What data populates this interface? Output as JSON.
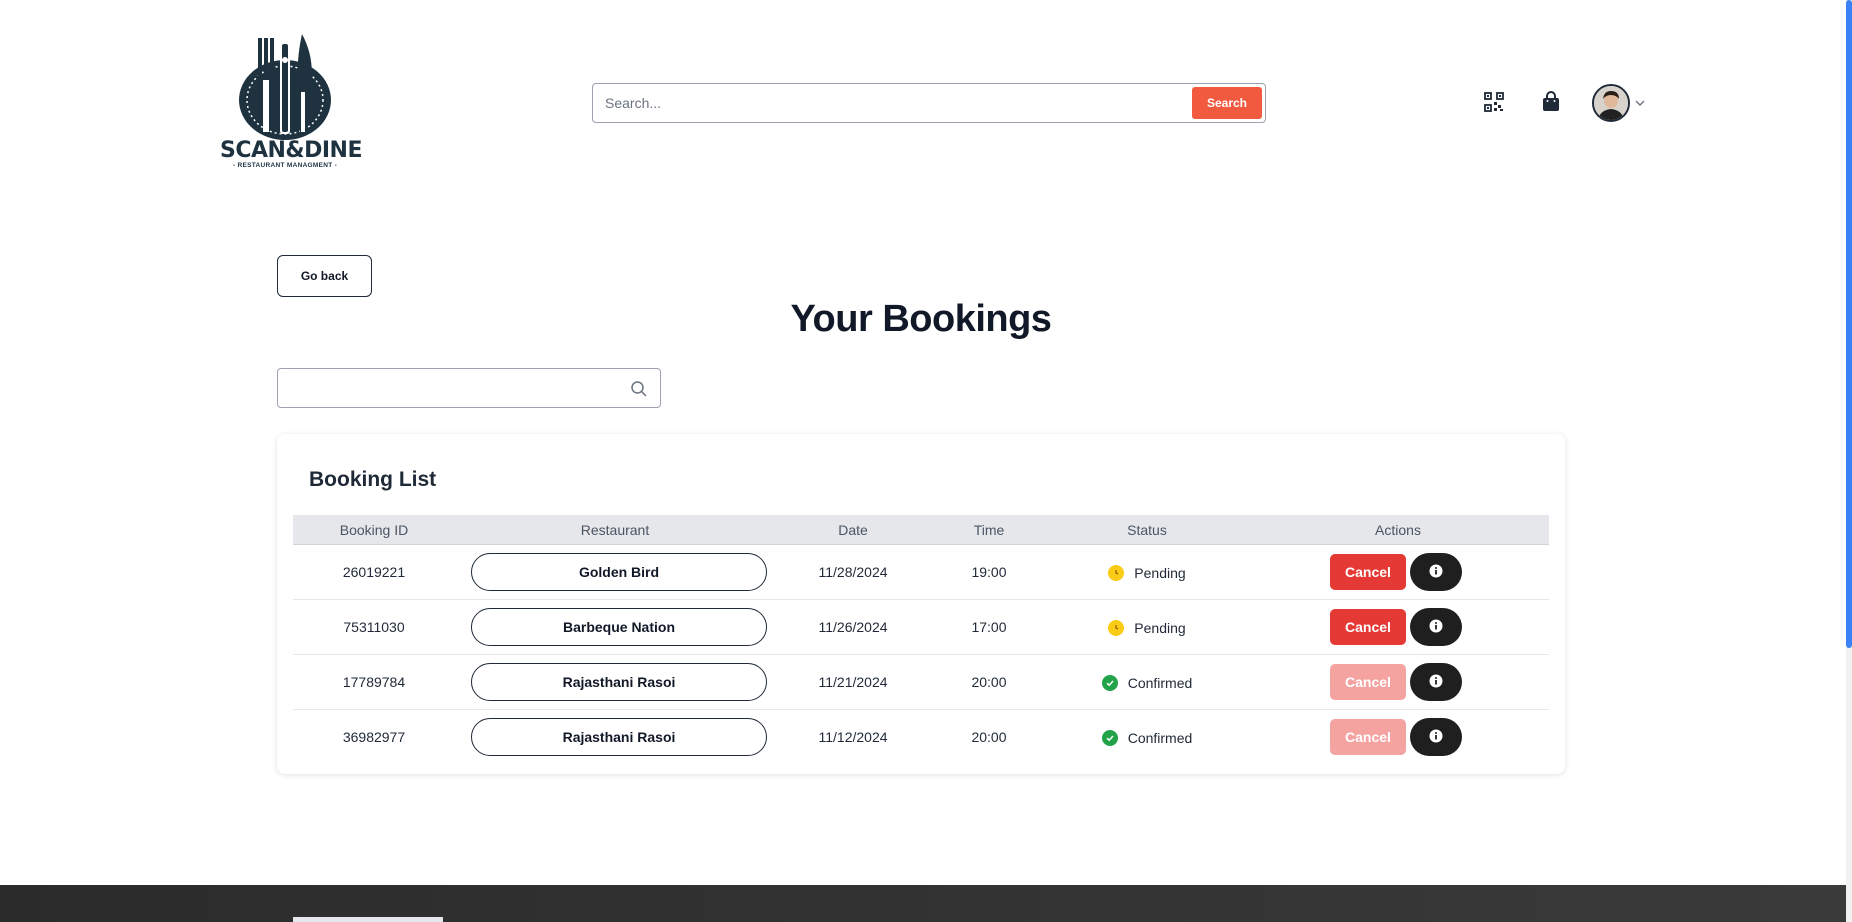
{
  "brand": {
    "name": "SCAN&DINE",
    "tagline": "- RESTAURANT MANAGMENT -"
  },
  "header": {
    "search_placeholder": "Search...",
    "search_button": "Search"
  },
  "page": {
    "go_back": "Go back",
    "title": "Your Bookings",
    "filter_placeholder": ""
  },
  "booking_list": {
    "title": "Booking List",
    "columns": [
      "Booking ID",
      "Restaurant",
      "Date",
      "Time",
      "Status",
      "Actions"
    ],
    "rows": [
      {
        "id": "26019221",
        "restaurant": "Golden Bird",
        "date": "11/28/2024",
        "time": "19:00",
        "status": "Pending",
        "cancel": "Cancel",
        "cancel_enabled": true
      },
      {
        "id": "75311030",
        "restaurant": "Barbeque Nation",
        "date": "11/26/2024",
        "time": "17:00",
        "status": "Pending",
        "cancel": "Cancel",
        "cancel_enabled": true
      },
      {
        "id": "17789784",
        "restaurant": "Rajasthani Rasoi",
        "date": "11/21/2024",
        "time": "20:00",
        "status": "Confirmed",
        "cancel": "Cancel",
        "cancel_enabled": false
      },
      {
        "id": "36982977",
        "restaurant": "Rajasthani Rasoi",
        "date": "11/12/2024",
        "time": "20:00",
        "status": "Confirmed",
        "cancel": "Cancel",
        "cancel_enabled": false
      }
    ]
  },
  "colors": {
    "accent": "#f15a3f",
    "cancel": "#e53935",
    "cancel_disabled": "#f4a3a1",
    "pending": "#facc15",
    "confirmed": "#22a34a",
    "scroll_thumb": "#3b82f6"
  },
  "icons": {
    "qr": "qr-code-icon",
    "bag": "shopping-bag-icon",
    "chevron": "chevron-down-icon",
    "search": "search-icon",
    "info": "info-icon",
    "pending": "clock-icon",
    "confirmed": "check-icon"
  }
}
